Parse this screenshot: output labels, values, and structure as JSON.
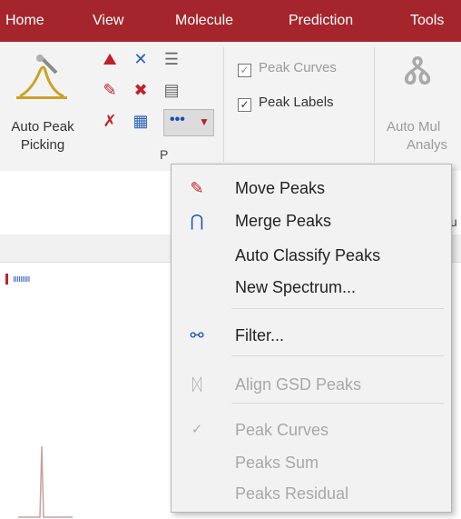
{
  "menubar": {
    "items": [
      "Home",
      "View",
      "Molecule",
      "Prediction",
      "Tools"
    ]
  },
  "ribbon": {
    "auto_peak_picking": [
      "Auto Peak",
      "Picking"
    ],
    "checks": [
      {
        "label": "Peak Curves",
        "checked": true,
        "disabled": true
      },
      {
        "label": "Peak Labels",
        "checked": true,
        "disabled": false
      }
    ],
    "auto_multiplet": [
      "Auto Mul",
      "Analys"
    ],
    "group_label_fragment": "P",
    "more_button_label": "•••",
    "side_fragment": "u"
  },
  "spectrum": {
    "peak_label_text": "ııııııııı"
  },
  "context_menu": {
    "items": [
      {
        "label": "Move Peaks",
        "icon": "move-peaks-icon",
        "disabled": false
      },
      {
        "label": "Merge Peaks",
        "icon": "merge-peaks-icon",
        "disabled": false
      },
      {
        "label": "Auto Classify Peaks",
        "icon": "",
        "disabled": false
      },
      {
        "label": "New Spectrum...",
        "icon": "",
        "disabled": false
      },
      {
        "label": "Filter...",
        "icon": "filter-icon",
        "disabled": false
      },
      {
        "label": "Align GSD Peaks",
        "icon": "align-peaks-icon",
        "disabled": true
      },
      {
        "label": "Peak Curves",
        "icon": "check-icon",
        "disabled": true
      },
      {
        "label": "Peaks Sum",
        "icon": "",
        "disabled": true
      },
      {
        "label": "Peaks Residual",
        "icon": "",
        "disabled": true
      }
    ]
  },
  "colors": {
    "menubar_bg": "#a4262c",
    "accent_red": "#c0202a",
    "accent_blue": "#2b5fb8"
  }
}
